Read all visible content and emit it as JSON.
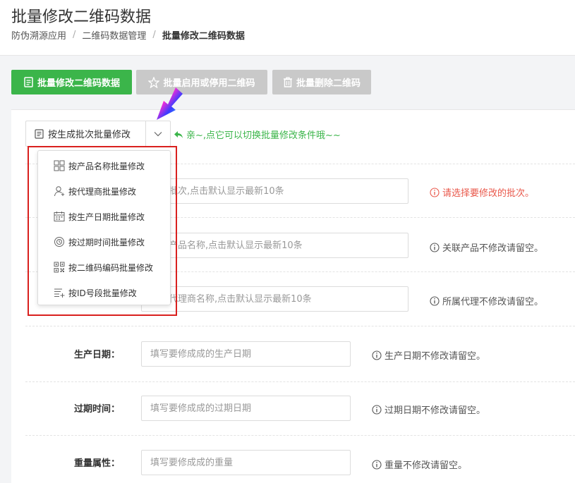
{
  "header": {
    "title": "批量修改二维码数据",
    "breadcrumb": [
      "防伪溯源应用",
      "二维码数据管理",
      "批量修改二维码数据"
    ],
    "separator": "/"
  },
  "toolbar": {
    "edit_label": "批量修改二维码数据",
    "enable_label": "批量启用或停用二维码",
    "delete_label": "批量删除二维码"
  },
  "mode": {
    "selected": "按生成批次批量修改",
    "tip": "亲~,点它可以切换批量修改条件哦~~",
    "options": [
      {
        "label": "按产品名称批量修改",
        "icon": "grid-icon"
      },
      {
        "label": "按代理商批量修改",
        "icon": "user-add-icon"
      },
      {
        "label": "按生产日期批量修改",
        "icon": "calendar-icon"
      },
      {
        "label": "按过期时间批量修改",
        "icon": "clock-icon"
      },
      {
        "label": "按二维码编码批量修改",
        "icon": "qrcode-icon"
      },
      {
        "label": "按ID号段批量修改",
        "icon": "list-add-icon"
      }
    ]
  },
  "fields": {
    "batch": {
      "placeholder": "搜索批次,点击默认显示最新10条",
      "hint": "请选择要修改的批次。"
    },
    "product": {
      "placeholder": "搜索产品名称,点击默认显示最新10条",
      "hint": "关联产品不修改请留空。"
    },
    "agent": {
      "placeholder": "搜索代理商名称,点击默认显示最新10条",
      "hint": "所属代理不修改请留空。"
    },
    "production_date": {
      "label": "生产日期：",
      "placeholder": "填写要修成成的生产日期",
      "hint": "生产日期不修改请留空。"
    },
    "expire_date": {
      "label": "过期时间：",
      "placeholder": "填写要修成成的过期日期",
      "hint": "过期日期不修改请留空。"
    },
    "weight": {
      "label": "重量属性：",
      "placeholder": "填写要修成成的重量",
      "hint": "重量不修改请留空。"
    }
  },
  "colors": {
    "primary": "#3bb54a",
    "disabled": "#c9c9c9",
    "error": "#e9584b",
    "highlight": "#d9201e"
  }
}
